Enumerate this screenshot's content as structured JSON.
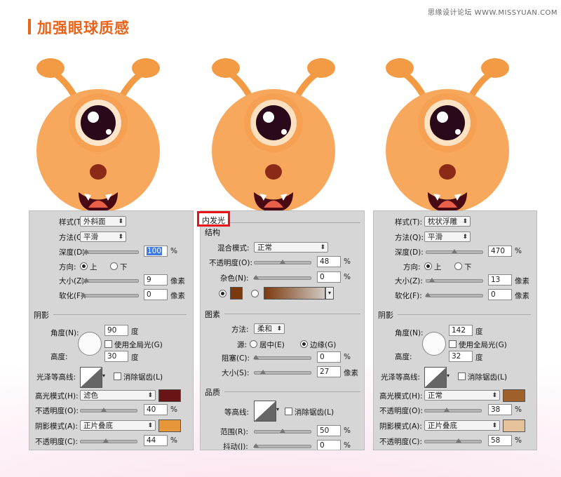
{
  "header": {
    "title": "加强眼球质感",
    "watermark": "思缘设计论坛 WWW.MISSYUAN.COM"
  },
  "colors": {
    "accent": "#e8641a",
    "monster": "#f6a054",
    "highlight": "#8a1c1c"
  },
  "left": {
    "style_label": "样式(T):",
    "style_value": "外斜面",
    "method_label": "方法(Q):",
    "method_value": "平滑",
    "depth_label": "深度(D):",
    "depth_value": "100",
    "depth_unit": "%",
    "direction_label": "方向:",
    "dir_up": "上",
    "dir_down": "下",
    "size_label": "大小(Z):",
    "size_value": "9",
    "size_unit": "像素",
    "soften_label": "软化(F):",
    "soften_value": "0",
    "soften_unit": "像素",
    "shading": "阴影",
    "angle_label": "角度(N):",
    "angle_value": "90",
    "angle_unit": "度",
    "global_light": "使用全局光(G)",
    "altitude_label": "高度:",
    "altitude_value": "30",
    "altitude_unit": "度",
    "gloss_label": "光泽等高线:",
    "antialias": "消除锯齿(L)",
    "hl_mode_label": "高光模式(H):",
    "hl_mode_value": "滤色",
    "hl_color": "#6a1515",
    "hl_opacity_label": "不透明度(O):",
    "hl_opacity_value": "40",
    "hl_opacity_unit": "%",
    "sh_mode_label": "阴影模式(A):",
    "sh_mode_value": "正片叠底",
    "sh_color": "#e8963a",
    "sh_opacity_label": "不透明度(C):",
    "sh_opacity_value": "44",
    "sh_opacity_unit": "%"
  },
  "middle": {
    "tab": "内发光",
    "struct": "结构",
    "blend_label": "混合模式:",
    "blend_value": "正常",
    "opacity_label": "不透明度(O):",
    "opacity_value": "48",
    "opacity_unit": "%",
    "noise_label": "杂色(N):",
    "noise_value": "0",
    "noise_unit": "%",
    "glow_color": "#7a3a0e",
    "elements": "图素",
    "technique_label": "方法:",
    "technique_value": "柔和",
    "source_label": "源:",
    "src_center": "居中(E)",
    "src_edge": "边缘(G)",
    "choke_label": "阻塞(C):",
    "choke_value": "0",
    "choke_unit": "%",
    "size_label": "大小(S):",
    "size_value": "27",
    "size_unit": "像素",
    "quality": "品质",
    "contour_label": "等高线:",
    "antialias": "消除锯齿(L)",
    "range_label": "范围(R):",
    "range_value": "50",
    "range_unit": "%",
    "jitter_label": "抖动(J):",
    "jitter_value": "0",
    "jitter_unit": "%"
  },
  "right": {
    "style_label": "样式(T):",
    "style_value": "枕状浮雕",
    "method_label": "方法(Q):",
    "method_value": "平滑",
    "depth_label": "深度(D):",
    "depth_value": "470",
    "depth_unit": "%",
    "direction_label": "方向:",
    "dir_up": "上",
    "dir_down": "下",
    "size_label": "大小(Z):",
    "size_value": "13",
    "size_unit": "像素",
    "soften_label": "软化(F):",
    "soften_value": "0",
    "soften_unit": "像素",
    "shading": "阴影",
    "angle_label": "角度(N):",
    "angle_value": "142",
    "angle_unit": "度",
    "global_light": "使用全局光(G)",
    "altitude_label": "高度:",
    "altitude_value": "32",
    "altitude_unit": "度",
    "gloss_label": "光泽等高线:",
    "antialias": "消除锯齿(L)",
    "hl_mode_label": "高光模式(H):",
    "hl_mode_value": "正常",
    "hl_color": "#a0602a",
    "hl_opacity_label": "不透明度(O):",
    "hl_opacity_value": "38",
    "hl_opacity_unit": "%",
    "sh_mode_label": "阴影模式(A):",
    "sh_mode_value": "正片叠底",
    "sh_color": "#e6c29a",
    "sh_opacity_label": "不透明度(C):",
    "sh_opacity_value": "58",
    "sh_opacity_unit": "%"
  }
}
